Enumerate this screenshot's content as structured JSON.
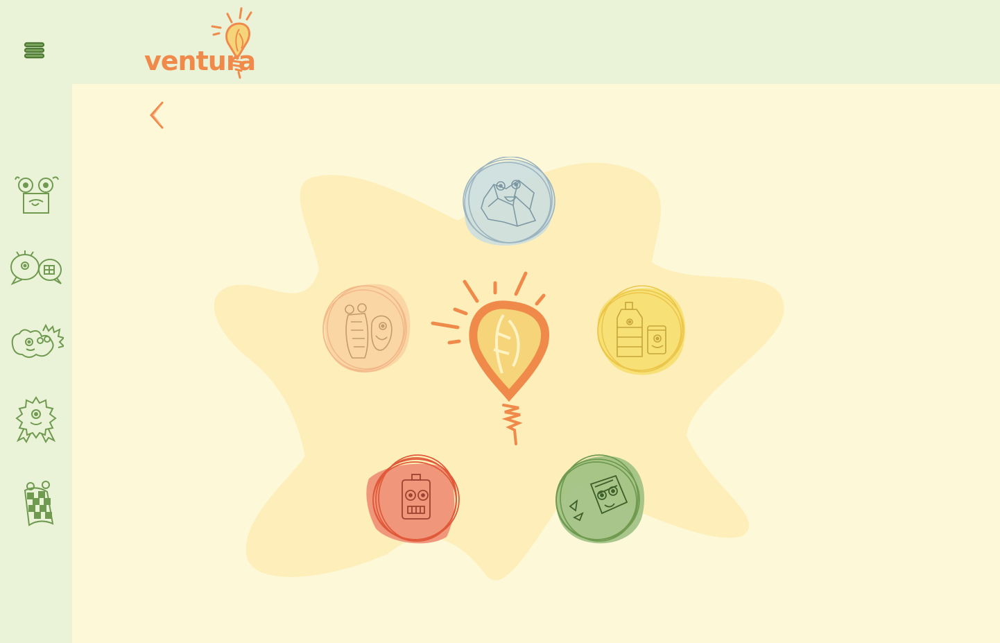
{
  "header": {
    "logo_text": "ventura",
    "menu_icon": "hamburger-menu-icon",
    "colors": {
      "bar": "#eaf2d8",
      "brand": "#f08a4b"
    }
  },
  "sidebar": {
    "items": [
      {
        "name": "sidebar-item-monster-box",
        "icon": "monster-box-icon"
      },
      {
        "name": "sidebar-item-chat",
        "icon": "chat-monster-icon"
      },
      {
        "name": "sidebar-item-group",
        "icon": "monster-group-icon"
      },
      {
        "name": "sidebar-item-award",
        "icon": "award-badge-icon"
      },
      {
        "name": "sidebar-item-finish",
        "icon": "checkered-flag-icon"
      }
    ],
    "color": "#6f9a4f"
  },
  "main": {
    "back_icon": "chevron-left-icon",
    "center_icon": "lightbulb-icon",
    "categories": [
      {
        "name": "category-paper",
        "icon": "crumpled-paper-icon",
        "color": "#c9dde0"
      },
      {
        "name": "category-organic",
        "icon": "organic-waste-icon",
        "color": "#f8d19f"
      },
      {
        "name": "category-plastic-metal",
        "icon": "bottle-can-icon",
        "color": "#f6dd6a"
      },
      {
        "name": "category-battery",
        "icon": "battery-icon",
        "color": "#ee8c74"
      },
      {
        "name": "category-glass",
        "icon": "glass-bottle-icon",
        "color": "#9fc083"
      }
    ]
  }
}
